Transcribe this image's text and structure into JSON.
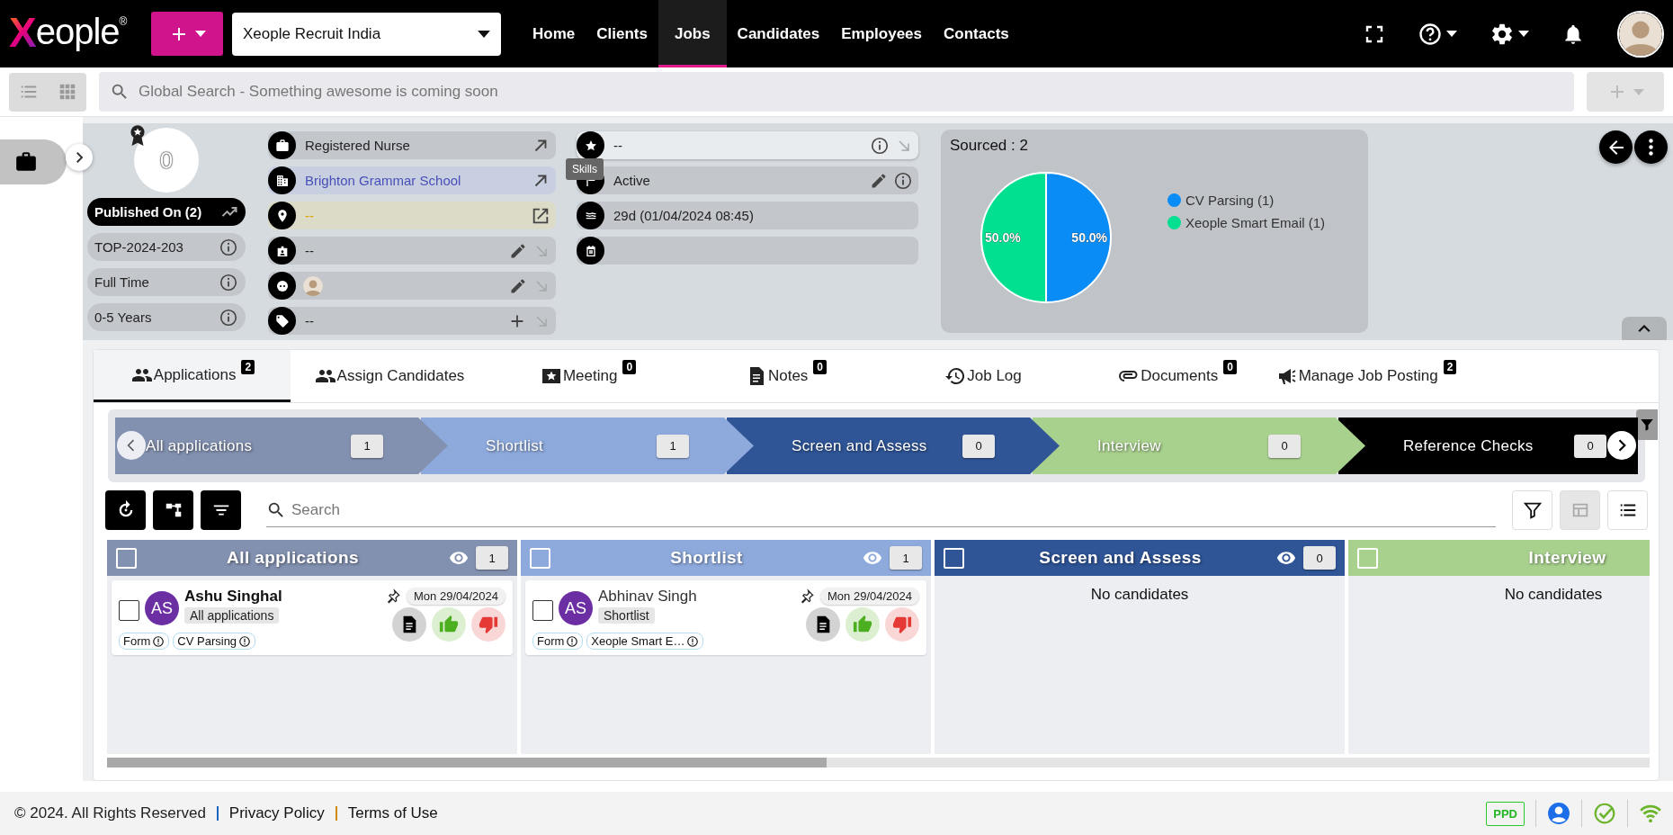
{
  "top_bar": {
    "logo": {
      "text": "Xeople",
      "mark": "®"
    },
    "company_select": {
      "value": "Xeople Recruit India"
    },
    "nav": [
      {
        "label": "Home",
        "selected": false
      },
      {
        "label": "Clients",
        "selected": false
      },
      {
        "label": "Jobs",
        "selected": true
      },
      {
        "label": "Candidates",
        "selected": false
      },
      {
        "label": "Employees",
        "selected": false
      },
      {
        "label": "Contacts",
        "selected": false
      }
    ]
  },
  "search": {
    "placeholder": "Global Search - Something awesome is coming soon"
  },
  "job_header": {
    "score": "0",
    "published": "Published On (2)",
    "facts": [
      "TOP-2024-203",
      "Full Time",
      "0-5 Years"
    ],
    "details": [
      {
        "kind": "text",
        "text": "Registered Nurse"
      },
      {
        "kind": "link",
        "text": "Brighton Grammar School"
      },
      {
        "kind": "location",
        "text": "--"
      },
      {
        "kind": "text",
        "text": "--"
      },
      {
        "kind": "avatar"
      },
      {
        "kind": "text",
        "text": "--"
      }
    ],
    "status": [
      {
        "text": "--",
        "hovered": true,
        "tooltip": "Skills"
      },
      {
        "text": "Active",
        "hovered": false
      },
      {
        "text": "29d (01/04/2024 08:45)",
        "hovered": false
      },
      {
        "hovered": false
      }
    ],
    "sourced": {
      "title": "Sourced : 2",
      "legend": [
        {
          "color": "#0a8cf7"
        },
        {
          "color": "#00e090"
        }
      ],
      "chart_data": {
        "type": "pie",
        "categories": [
          "CV Parsing (1)",
          "Xeople Smart Email (1)"
        ],
        "values": [
          50,
          50
        ],
        "value_labels": [
          "50.0%",
          "50.0%"
        ]
      }
    }
  },
  "tabs": [
    {
      "label": "Applications",
      "count": "2",
      "selected": true
    },
    {
      "label": "Assign Candidates",
      "selected": false
    },
    {
      "label": "Meeting",
      "count": "0",
      "selected": false
    },
    {
      "label": "Notes",
      "count": "0",
      "selected": false
    },
    {
      "label": "Job Log",
      "selected": false
    },
    {
      "label": "Documents",
      "count": "0",
      "selected": false
    },
    {
      "label": "Manage Job Posting",
      "count": "2",
      "selected": false
    }
  ],
  "pipeline": [
    {
      "label": "All applications",
      "count": "1",
      "color": "#8391b0"
    },
    {
      "label": "Shortlist",
      "count": "1",
      "color": "#8eaadc"
    },
    {
      "label": "Screen and Assess",
      "count": "0",
      "color": "#2f5597"
    },
    {
      "label": "Interview",
      "count": "0",
      "color": "#a9d18e"
    },
    {
      "label": "Reference Checks",
      "count": "0",
      "color": "#000000"
    }
  ],
  "board": {
    "search": {
      "placeholder": "Search"
    },
    "columns": [
      {
        "title": "All applications",
        "count": "1",
        "color": "#8391b0",
        "checked": false,
        "cards": [
          {
            "checked": false,
            "name": "Ashu Singhal",
            "initials": "AS",
            "unread": true,
            "stage": "All applications",
            "date": "Mon 29/04/2024",
            "tags": [
              "Form",
              "CV Parsing"
            ]
          }
        ]
      },
      {
        "title": "Shortlist",
        "count": "1",
        "color": "#8eaadc",
        "checked": false,
        "cards": [
          {
            "checked": false,
            "name": "Abhinav Singh",
            "initials": "AS",
            "unread": false,
            "stage": "Shortlist",
            "date": "Mon 29/04/2024",
            "tags": [
              "Form",
              "Xeople Smart E…"
            ]
          }
        ]
      },
      {
        "title": "Screen and Assess",
        "count": "0",
        "color": "#2f5597",
        "checked": false,
        "empty_text": "No candidates"
      },
      {
        "title": "Interview",
        "color": "#a9d18e",
        "checked": false,
        "empty_text": "No candidates"
      }
    ]
  },
  "footer": {
    "copyright": "© 2024. All Rights Reserved",
    "links": [
      "Privacy Policy",
      "Terms of Use"
    ],
    "badge": "PPD"
  }
}
